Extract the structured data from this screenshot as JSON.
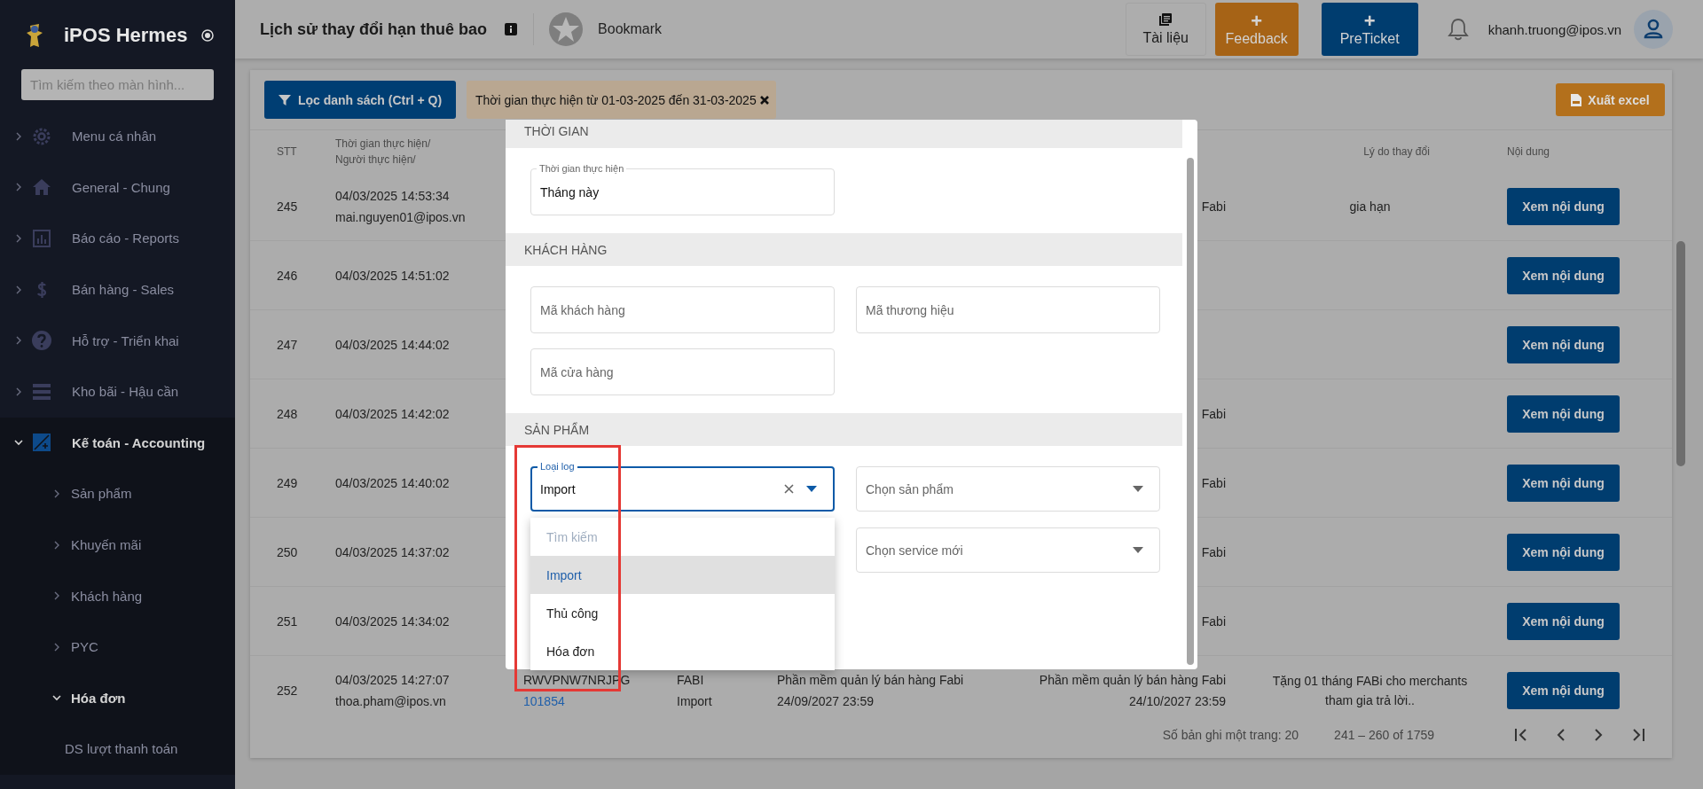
{
  "sidebar": {
    "brand": "iPOS Hermes",
    "search": {
      "placeholder": "Tìm kiếm theo màn hình..."
    },
    "items": [
      {
        "label": "Menu cá nhân",
        "expanded": false
      },
      {
        "label": "General - Chung",
        "expanded": false
      },
      {
        "label": "Báo cáo - Reports",
        "expanded": false
      },
      {
        "label": "Bán hàng - Sales",
        "expanded": false
      },
      {
        "label": "Hỗ trợ - Triển khai",
        "expanded": false
      },
      {
        "label": "Kho bãi - Hậu cần",
        "expanded": false
      },
      {
        "label": "Kế toán - Accounting",
        "expanded": true,
        "children": [
          {
            "label": "Sản phẩm",
            "expanded": false
          },
          {
            "label": "Khuyến mãi",
            "expanded": false
          },
          {
            "label": "Khách hàng",
            "expanded": false
          },
          {
            "label": "PYC",
            "expanded": false
          },
          {
            "label": "Hóa đơn",
            "expanded": true,
            "children": [
              {
                "label": "DS lượt thanh toán"
              }
            ]
          }
        ]
      }
    ]
  },
  "header": {
    "title": "Lịch sử thay đổi hạn thuê bao",
    "bookmark": "Bookmark",
    "docs": "Tài liệu",
    "feedback": {
      "icon": "+",
      "label": "Feedback"
    },
    "preticket": {
      "icon": "+",
      "label": "PreTicket"
    },
    "user": "khanh.truong@ipos.vn"
  },
  "toolbar": {
    "filter_button": "Lọc danh sách (Ctrl + Q)",
    "filter_chip": "Thời gian thực hiện từ 01-03-2025 đến 31-03-2025",
    "export_button": "Xuất excel"
  },
  "table": {
    "columns": [
      {
        "label": "STT"
      },
      {
        "label": "Thời gian thực hiện/ Người thực hiện/"
      },
      {
        "label": "Lý do thay đổi"
      },
      {
        "label": "Nội dung"
      }
    ],
    "rows": [
      {
        "stt": "245",
        "time": "04/03/2025 14:53:34",
        "user": "mai.nguyen01@ipos.vn",
        "column_6": "Fabi",
        "reason": "gia hạn",
        "action": "Xem nội dung"
      },
      {
        "stt": "246",
        "time": "04/03/2025 14:51:02",
        "action": "Xem nội dung"
      },
      {
        "stt": "247",
        "time": "04/03/2025 14:44:02",
        "action": "Xem nội dung"
      },
      {
        "stt": "248",
        "time": "04/03/2025 14:42:02",
        "column_6": "Fabi",
        "action": "Xem nội dung"
      },
      {
        "stt": "249",
        "time": "04/03/2025 14:40:02",
        "column_6": "Fabi",
        "action": "Xem nội dung"
      },
      {
        "stt": "250",
        "time": "04/03/2025 14:37:02",
        "column_6": "Fabi",
        "action": "Xem nội dung"
      },
      {
        "stt": "251",
        "time": "04/03/2025 14:34:02",
        "column_6": "Fabi",
        "action": "Xem nội dung"
      },
      {
        "stt": "252",
        "time": "04/03/2025 14:27:07",
        "user": "thoa.pham@ipos.vn",
        "code": "RWVPNW7NRJPG",
        "code_link": "101854",
        "column_4": "FABI",
        "column_4_sub": "Import",
        "column_5": "Phần mềm quản lý bán hàng Fabi",
        "column_5_sub": "24/09/2027 23:59",
        "column_6": "Phần mềm quản lý bán hàng Fabi",
        "column_6_sub": "24/10/2027 23:59",
        "reason": "Tặng 01 tháng FABi cho merchants tham gia trả lời..",
        "action": "Xem nội dung"
      }
    ]
  },
  "pagination": {
    "page_size": "Số bản ghi một trang: 20",
    "range": "241 – 260 of 1759"
  },
  "filter_dialog": {
    "sections": [
      {
        "title": "THỜI GIAN",
        "fields": [
          {
            "kind": "input",
            "label": "Thời gian thực hiện",
            "value": "Tháng này"
          }
        ]
      },
      {
        "title": "KHÁCH HÀNG",
        "fields": [
          {
            "kind": "input",
            "placeholder": "Mã khách hàng"
          },
          {
            "kind": "input",
            "placeholder": "Mã thương hiệu"
          },
          {
            "kind": "input",
            "placeholder": "Mã cửa hàng"
          }
        ]
      },
      {
        "title": "SẢN PHẨM",
        "fields": [
          {
            "kind": "select",
            "label": "Loại log",
            "value": "Import",
            "focused": true
          },
          {
            "kind": "select",
            "placeholder": "Chọn sản phẩm",
            "focused": false
          },
          {
            "kind": "select",
            "placeholder": "Chọn service mới",
            "focused": false
          }
        ]
      }
    ],
    "dropdown": {
      "search_placeholder": "Tìm kiếm",
      "options": [
        {
          "label": "Import",
          "selected": true
        },
        {
          "label": "Thủ công",
          "selected": false
        },
        {
          "label": "Hóa đơn",
          "selected": false
        }
      ]
    }
  }
}
